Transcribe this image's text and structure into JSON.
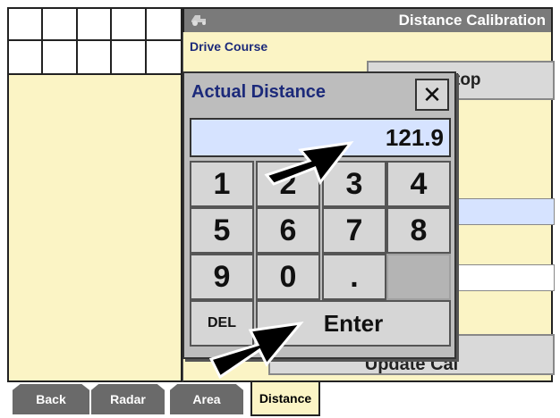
{
  "screen_title": "Distance Calibration",
  "section_label": "Drive Course",
  "background_button": "top",
  "update_button": "Update Cal",
  "dialog": {
    "title": "Actual Distance",
    "close": "✕",
    "value": "121.9",
    "keys": {
      "k1": "1",
      "k2": "2",
      "k3": "3",
      "k4": "4",
      "k5": "5",
      "k6": "6",
      "k7": "7",
      "k8": "8",
      "k9": "9",
      "k0": "0",
      "kdot": ".",
      "del": "DEL",
      "enter": "Enter"
    }
  },
  "tabs": {
    "back": "Back",
    "radar": "Radar",
    "area": "Area",
    "distance": "Distance"
  },
  "icons": {
    "title_icon": "tractor-icon"
  },
  "colors": {
    "panel_bg": "#fbf4c5",
    "title_bar": "#7a7a7a",
    "display_bg": "#d6e3ff",
    "tab_bg": "#6a6a6a"
  }
}
